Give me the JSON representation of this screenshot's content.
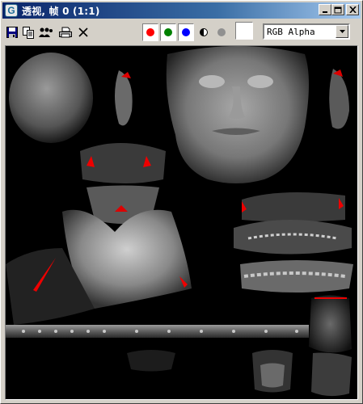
{
  "window": {
    "app_icon": "3ds-max-app-icon",
    "title": "透视, 帧 0 (1:1)",
    "controls": [
      "minimize-icon",
      "maximize-icon",
      "close-icon"
    ]
  },
  "toolbar": {
    "tools": [
      "save-icon",
      "copy-icon",
      "clone-icon",
      "print-icon",
      "clear-icon"
    ],
    "channels": [
      {
        "name": "red",
        "color": "#ff0000",
        "active": true
      },
      {
        "name": "green",
        "color": "#008000",
        "active": true
      },
      {
        "name": "blue",
        "color": "#0000ff",
        "active": true
      },
      {
        "name": "alpha",
        "icon": "half-circle-icon"
      },
      {
        "name": "mono",
        "color": "#909090"
      }
    ],
    "swatch_color": "#ffffff",
    "channel_select": {
      "value": "RGB Alpha"
    }
  },
  "viewport": {
    "background": "#000000",
    "content": "unwrapped-head-texture-render",
    "accent_color": "#ff1010"
  }
}
